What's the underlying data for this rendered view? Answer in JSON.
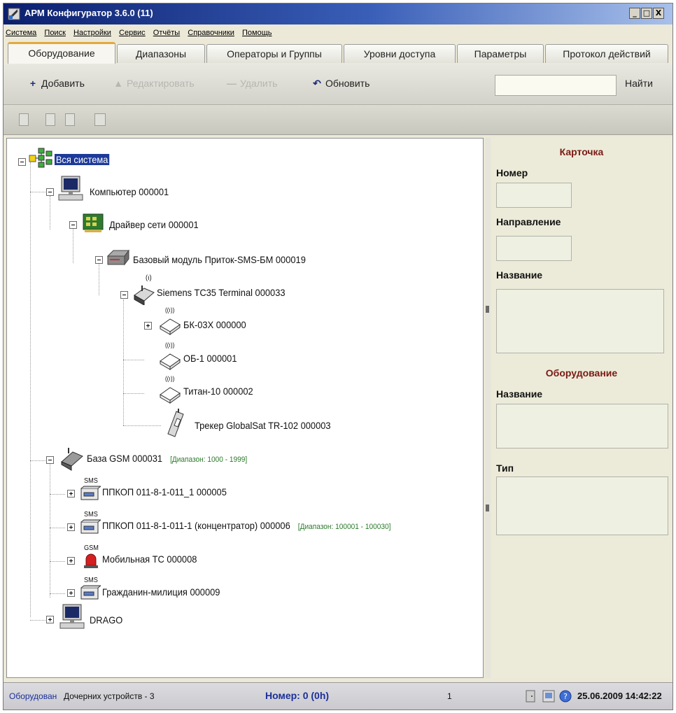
{
  "window": {
    "title": "АРМ Конфигуратор 3.6.0 (11)",
    "btn_min": "_",
    "btn_max": "□",
    "btn_close": "X"
  },
  "menu": [
    "Система",
    "Поиск",
    "Настройки",
    "Сервис",
    "Отчёты",
    "Справочники",
    "Помощь"
  ],
  "tabs": [
    "Оборудование",
    "Диапазоны",
    "Операторы и Группы",
    "Уровни доступа",
    "Параметры",
    "Протокол действий"
  ],
  "toolbar": {
    "add": "Добавить",
    "add_icon": "+",
    "edit": "Редактировать",
    "edit_icon": "▲",
    "delete": "Удалить",
    "delete_icon": "—",
    "refresh": "Обновить",
    "refresh_icon": "↶",
    "search_value": "",
    "find": "Найти"
  },
  "tree": {
    "root": "Вся система",
    "computer1": "Компьютер 000001",
    "driver": "Драйвер сети 000001",
    "base_module": "Базовый модуль Приток-SMS-БМ 000019",
    "terminal": "Siemens TC35 Terminal 000033",
    "bk": "БК-03Х 000000",
    "ob": "ОБ-1 000001",
    "titan": "Титан-10 000002",
    "tracker": "Трекер GlobalSat TR-102 000003",
    "gsm_base": "База GSM 000031",
    "gsm_base_range": "[Диапазон: 1000 - 1999]",
    "ppkop1": "ППКОП 011-8-1-011_1 000005",
    "ppkop2": "ППКОП 011-8-1-011-1 (концентратор) 000006",
    "ppkop2_range": "[Диапазон: 100001 - 100030]",
    "mobile": "Мобильная ТС 000008",
    "citizen": "Гражданин-милиция 000009",
    "drago": "DRAGO",
    "sms_tag": "SMS",
    "gsm_tag": "GSM",
    "wave_tag": "((ı))"
  },
  "card": {
    "title": "Карточка",
    "number_label": "Номер",
    "number_value": "",
    "direction_label": "Направление",
    "direction_value": "",
    "name_label": "Название",
    "name_value": "",
    "equipment_title": "Оборудование",
    "eq_name_label": "Название",
    "eq_name_value": "",
    "type_label": "Тип",
    "type_value": ""
  },
  "status": {
    "equipment": "Оборудован",
    "children": "Дочерних устройств - 3",
    "number": "Номер: 0 (0h)",
    "count": "1",
    "datetime": "25.06.2009 14:42:22"
  }
}
